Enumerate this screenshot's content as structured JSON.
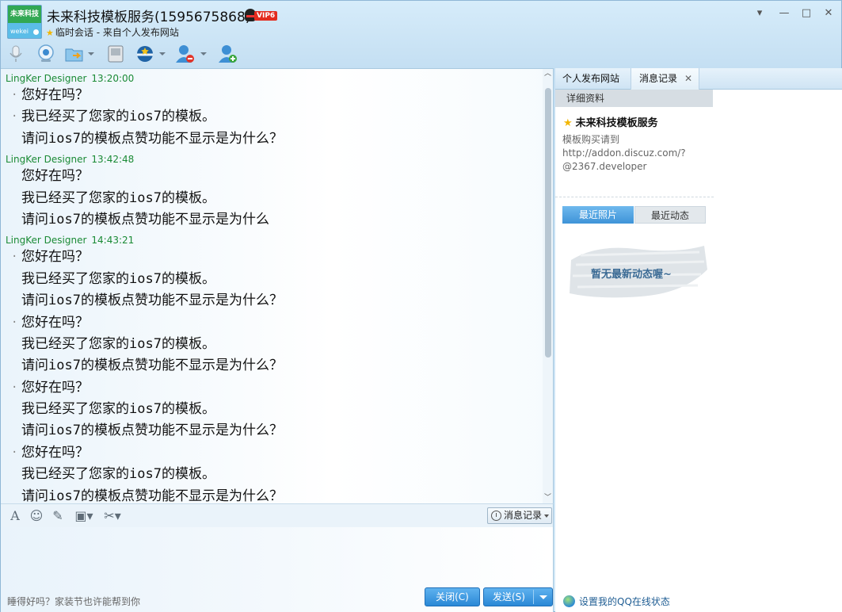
{
  "window": {
    "avatar_top": "未来科技",
    "avatar_bottom": "wekei",
    "title": "未来科技模板服务(1595675868)",
    "vip_label": "VIP6",
    "subtitle": "临时会话 - 来自个人发布网站",
    "controls": {
      "dropdown": "▾",
      "minimize": "—",
      "maximize": "□",
      "close": "✕"
    }
  },
  "toolbar": {
    "icons": [
      "microphone-icon",
      "video-icon",
      "file-transfer-icon",
      "screen-icon",
      "app-center-icon",
      "remove-contact-icon",
      "add-contact-icon"
    ]
  },
  "chat": {
    "messages": [
      {
        "sender": "LingKer Designer",
        "time": "13:20:00",
        "lines": [
          "您好在吗？",
          "我已经买了您家的ios7的模板。",
          "请问ios7的模板点赞功能不显示是为什么？"
        ]
      },
      {
        "sender": "LingKer Designer",
        "time": "13:42:48",
        "lines": [
          "您好在吗？",
          "我已经买了您家的ios7的模板。",
          "请问ios7的模板点赞功能不显示是为什么"
        ]
      },
      {
        "sender": "LingKer Designer",
        "time": "14:43:21",
        "lines": [
          "您好在吗？",
          "我已经买了您家的ios7的模板。",
          "请问ios7的模板点赞功能不显示是为什么？",
          "您好在吗？",
          "我已经买了您家的ios7的模板。",
          "请问ios7的模板点赞功能不显示是为什么？",
          "您好在吗？",
          "我已经买了您家的ios7的模板。",
          "请问ios7的模板点赞功能不显示是为什么？",
          "您好在吗？",
          "我已经买了您家的ios7的模板。",
          "请问ios7的模板点赞功能不显示是为什么？"
        ]
      }
    ]
  },
  "input_toolbar": {
    "history_label": "消息记录"
  },
  "input": {
    "hint": "睡得好吗？家装节也许能帮到你",
    "close_label": "关闭(C)",
    "send_label": "发送(S)"
  },
  "right_panel": {
    "tabs": [
      "个人发布网站",
      "消息记录"
    ],
    "detail_label": "详细资料",
    "name": "未来科技模板服务",
    "desc_lines": [
      "模板购买请到",
      "http://addon.discuz.com/?",
      "@2367.developer"
    ],
    "photo_tabs": [
      "最近照片",
      "最近动态"
    ],
    "empty_text": "暂无最新动态喔~",
    "qq_status": "设置我的QQ在线状态"
  }
}
